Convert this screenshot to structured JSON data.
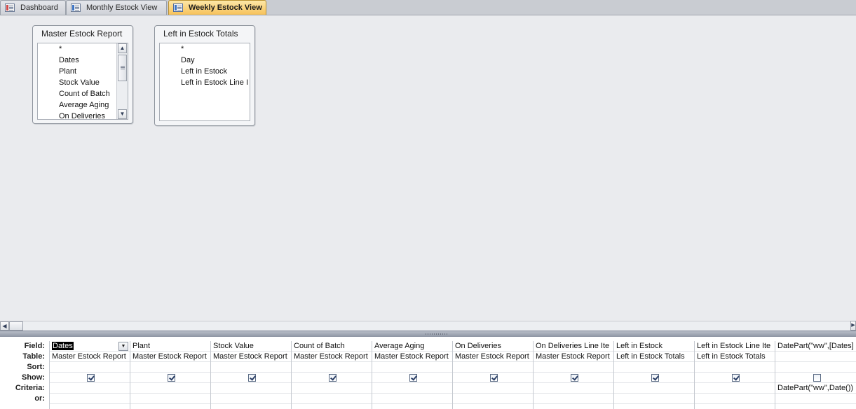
{
  "tabs": [
    {
      "label": "Dashboard",
      "active": false
    },
    {
      "label": "Monthly Estock View",
      "active": false
    },
    {
      "label": "Weekly Estock View",
      "active": true
    }
  ],
  "tables": [
    {
      "title": "Master Estock Report",
      "fields": [
        "*",
        "Dates",
        "Plant",
        "Stock Value",
        "Count of Batch",
        "Average Aging",
        "On Deliveries"
      ]
    },
    {
      "title": "Left in Estock Totals",
      "fields": [
        "*",
        "Day",
        "Left in Estock",
        "Left in Estock Line I"
      ]
    }
  ],
  "grid": {
    "row_labels": [
      "Field:",
      "Table:",
      "Sort:",
      "Show:",
      "Criteria:",
      "or:"
    ],
    "columns": [
      {
        "field": "Dates",
        "table": "Master Estock Report",
        "sort": "",
        "show": true,
        "criteria": "",
        "or": ""
      },
      {
        "field": "Plant",
        "table": "Master Estock Report",
        "sort": "",
        "show": true,
        "criteria": "",
        "or": ""
      },
      {
        "field": "Stock Value",
        "table": "Master Estock Report",
        "sort": "",
        "show": true,
        "criteria": "",
        "or": ""
      },
      {
        "field": "Count of Batch",
        "table": "Master Estock Report",
        "sort": "",
        "show": true,
        "criteria": "",
        "or": ""
      },
      {
        "field": "Average Aging",
        "table": "Master Estock Report",
        "sort": "",
        "show": true,
        "criteria": "",
        "or": ""
      },
      {
        "field": "On Deliveries",
        "table": "Master Estock Report",
        "sort": "",
        "show": true,
        "criteria": "",
        "or": ""
      },
      {
        "field": "On Deliveries Line Ite",
        "table": "Master Estock Report",
        "sort": "",
        "show": true,
        "criteria": "",
        "or": ""
      },
      {
        "field": "Left in Estock",
        "table": "Left in Estock Totals",
        "sort": "",
        "show": true,
        "criteria": "",
        "or": ""
      },
      {
        "field": "Left in Estock Line Ite",
        "table": "Left in Estock Totals",
        "sort": "",
        "show": true,
        "criteria": "",
        "or": ""
      },
      {
        "field": "DatePart(\"ww\",[Dates]",
        "table": "",
        "sort": "",
        "show": false,
        "criteria": "DatePart(\"ww\",Date())",
        "or": ""
      }
    ]
  }
}
